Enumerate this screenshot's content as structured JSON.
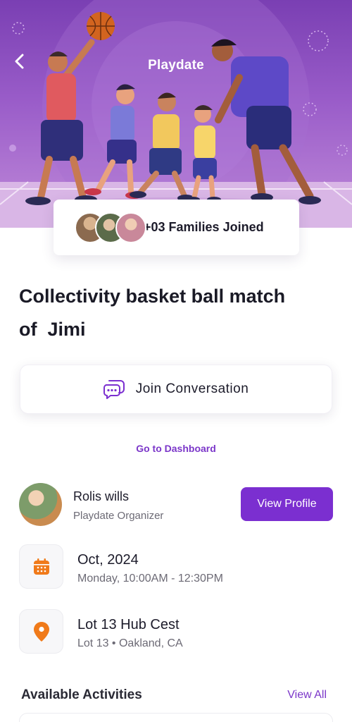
{
  "header": {
    "title": "Playdate",
    "back_icon": "chevron-left-icon"
  },
  "families": {
    "label": "+03 Families Joined",
    "avatar_count": 3
  },
  "event": {
    "title_line1": "Collectivity basket ball match",
    "title_line2": "of  Jimi"
  },
  "join": {
    "label": "Join Conversation",
    "icon": "chat-bubbles-icon"
  },
  "dashboard_link": "Go to Dashboard",
  "organizer": {
    "name": "Rolis wills",
    "role": "Playdate Organizer",
    "button": "View Profile"
  },
  "date": {
    "title": "Oct, 2024",
    "subtitle": "Monday, 10:00AM - 12:30PM",
    "icon": "calendar-icon"
  },
  "location": {
    "title": "Lot 13 Hub Cest",
    "subtitle": "Lot 13 • Oakland, CA",
    "icon": "location-pin-icon"
  },
  "activities": {
    "heading": "Available Activities",
    "view_all": "View All"
  },
  "colors": {
    "accent": "#7b2fd0",
    "icon_orange": "#f07a1a",
    "hero_purple": "#8a4cc0"
  }
}
